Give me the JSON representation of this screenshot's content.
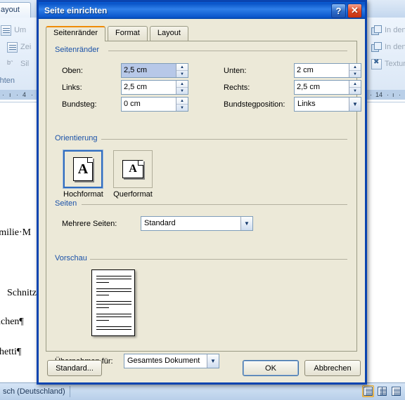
{
  "background_app": {
    "ribbon_tab": "ayout",
    "ribbon_items_left": [
      {
        "label": "Um",
        "icon": "page-breaks-icon"
      },
      {
        "label": "Zei",
        "icon": "line-numbers-icon"
      },
      {
        "label": "Sil",
        "icon": "hyphenation-icon"
      }
    ],
    "ribbon_group_label": "richten",
    "ribbon_items_right": [
      {
        "label": "In den",
        "icon": "bring-to-front-icon"
      },
      {
        "label": "In den",
        "icon": "send-to-back-icon"
      },
      {
        "label": "Textum",
        "icon": "text-wrapping-icon"
      }
    ],
    "ruler_ticks_left": [
      "·",
      "ı",
      "·",
      "4",
      "·"
    ],
    "ruler_ticks_right": [
      "·",
      "14",
      "·",
      "ı",
      "·"
    ],
    "document_lines": [
      "amilie·M",
      "Schnitz",
      "nchen¶",
      "ghetti¶"
    ],
    "statusbar": {
      "language": "sch (Deutschland)",
      "views": [
        {
          "name": "print-layout-view",
          "selected": true
        },
        {
          "name": "full-screen-reading-view",
          "selected": false
        },
        {
          "name": "web-layout-view",
          "selected": false
        }
      ]
    }
  },
  "dialog": {
    "title": "Seite einrichten",
    "titlebar_buttons": [
      {
        "name": "help-button",
        "glyph": "?"
      },
      {
        "name": "close-button",
        "glyph": "✕"
      }
    ],
    "tabs": [
      {
        "label": "Seitenränder",
        "active": true
      },
      {
        "label": "Format",
        "active": false
      },
      {
        "label": "Layout",
        "active": false
      }
    ],
    "group_margins": {
      "title": "Seitenränder",
      "fields": [
        {
          "label": "Oben:",
          "value": "2,5 cm",
          "selected": true,
          "type": "spinner"
        },
        {
          "label": "Unten:",
          "value": "2 cm",
          "selected": false,
          "type": "spinner"
        },
        {
          "label": "Links:",
          "value": "2,5 cm",
          "selected": false,
          "type": "spinner"
        },
        {
          "label": "Rechts:",
          "value": "2,5 cm",
          "selected": false,
          "type": "spinner"
        },
        {
          "label": "Bundsteg:",
          "value": "0 cm",
          "selected": false,
          "type": "spinner"
        },
        {
          "label": "Bundstegposition:",
          "value": "Links",
          "selected": false,
          "type": "combo"
        }
      ]
    },
    "group_orientation": {
      "title": "Orientierung",
      "options": [
        {
          "label": "Hochformat",
          "selected": true,
          "glyph": "A"
        },
        {
          "label": "Querformat",
          "selected": false,
          "glyph": "A"
        }
      ]
    },
    "group_pages": {
      "title": "Seiten",
      "label": "Mehrere Seiten:",
      "value": "Standard"
    },
    "group_preview": {
      "title": "Vorschau",
      "apply_label": "Übernehmen für:",
      "apply_value": "Gesamtes Dokument"
    },
    "buttons": [
      {
        "name": "default-button",
        "label": "Standard...",
        "default": false
      },
      {
        "name": "ok-button",
        "label": "OK",
        "default": true
      },
      {
        "name": "cancel-button",
        "label": "Abbrechen",
        "default": false
      }
    ]
  },
  "colors": {
    "dialog_face": "#ece9d8",
    "title_blue": "#0b57cc",
    "group_title_blue": "#1a51a8",
    "active_tab_accent": "#ef8c08",
    "selection_blue": "#b7c8e8",
    "field_border": "#7f9db9"
  }
}
